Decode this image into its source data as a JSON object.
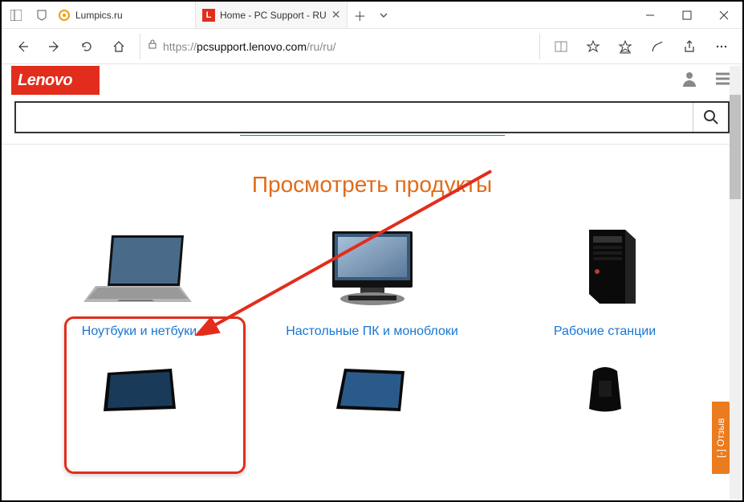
{
  "tabs": [
    {
      "title": "Lumpics.ru",
      "favicon": "orange"
    },
    {
      "title": "Home - PC Support - RU",
      "favicon": "lenovo-L"
    }
  ],
  "url": {
    "proto": "https://",
    "host": "pcsupport.lenovo.com",
    "path": "/ru/ru/"
  },
  "logo": "Lenovo",
  "section_title": "Просмотреть продукты",
  "products": [
    {
      "label": "Ноутбуки и нетбуки"
    },
    {
      "label": "Настольные ПК и моноблоки"
    },
    {
      "label": "Рабочие станции"
    }
  ],
  "feedback_label": "[-] Отзыв"
}
